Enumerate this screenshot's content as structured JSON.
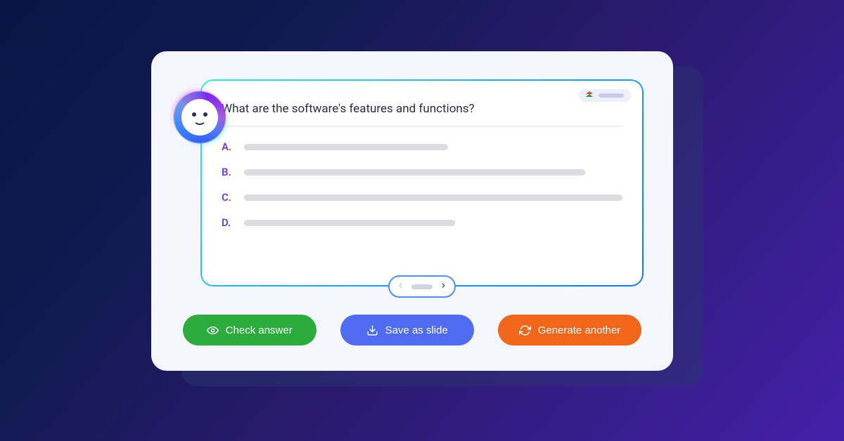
{
  "question": "What are the software's features and functions?",
  "options": {
    "a": "A.",
    "b": "B.",
    "c": "C.",
    "d": "D."
  },
  "buttons": {
    "check": "Check answer",
    "save": "Save as slide",
    "generate": "Generate another"
  }
}
